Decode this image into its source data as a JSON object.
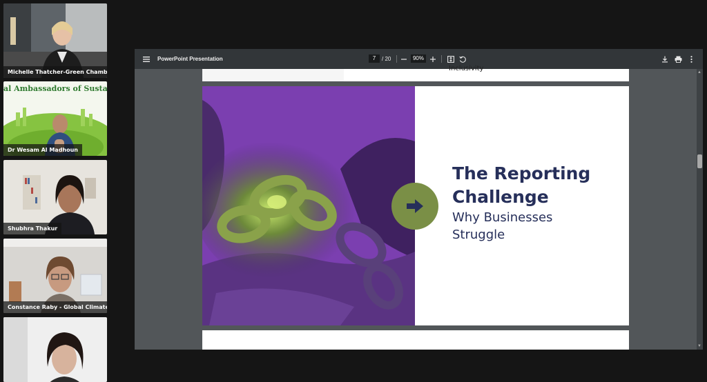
{
  "participants": [
    {
      "name": "Michelle Thatcher-Green Chambe..."
    },
    {
      "name": "Dr Wesam Al Madhoun",
      "banner": "al Ambassadors of Sustaina"
    },
    {
      "name": "Shubhra Thakur"
    },
    {
      "name": "Constance Raby - Global Climate ..."
    },
    {
      "name": ""
    }
  ],
  "viewer": {
    "title": "PowerPoint Presentation",
    "current_page": "7",
    "total_pages": "/ 20",
    "zoom": "90%",
    "icons": [
      "menu-icon",
      "zoom-out-icon",
      "zoom-in-icon",
      "fit-page-icon",
      "rotate-icon",
      "download-icon",
      "print-icon",
      "more-options-icon"
    ]
  },
  "previous_page": {
    "trailing_text": "Inclusivity"
  },
  "slide": {
    "title": "The Reporting Challenge",
    "subtitle": "Why Businesses Struggle",
    "accent_color": "#7a8f46",
    "text_color": "#262f5a",
    "photo_tint": "#7b3fb0"
  }
}
